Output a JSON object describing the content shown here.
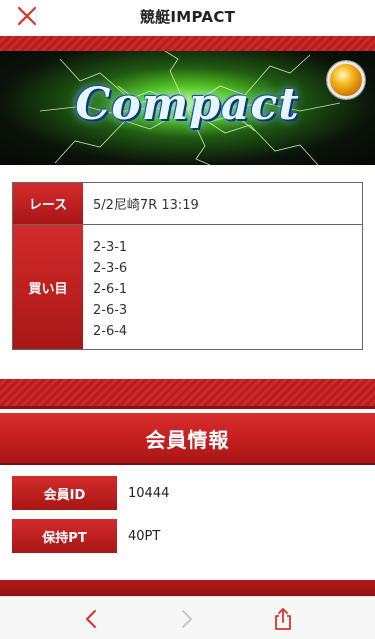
{
  "topbar": {
    "title": "競艇IMPACT",
    "close_icon": "close-icon"
  },
  "banner": {
    "logo_text": "Compact",
    "medal_icon": "medal-icon"
  },
  "race_info": {
    "race_label": "レース",
    "race_value": "5/2尼崎7R 13:19",
    "buy_label": "買い目",
    "buy_items": [
      "2-3-1",
      "2-3-6",
      "2-6-1",
      "2-6-3",
      "2-6-4"
    ]
  },
  "member": {
    "title": "会員情報",
    "id_label": "会員ID",
    "id_value": "10444",
    "pt_label": "保持PT",
    "pt_value": "40PT"
  },
  "bottombar": {
    "back_icon": "chevron-left-icon",
    "forward_icon": "chevron-right-icon",
    "share_icon": "share-icon"
  },
  "colors": {
    "accent_red": "#c21f1f",
    "ios_red": "#e0302b",
    "disabled_gray": "#c8c8c8"
  }
}
